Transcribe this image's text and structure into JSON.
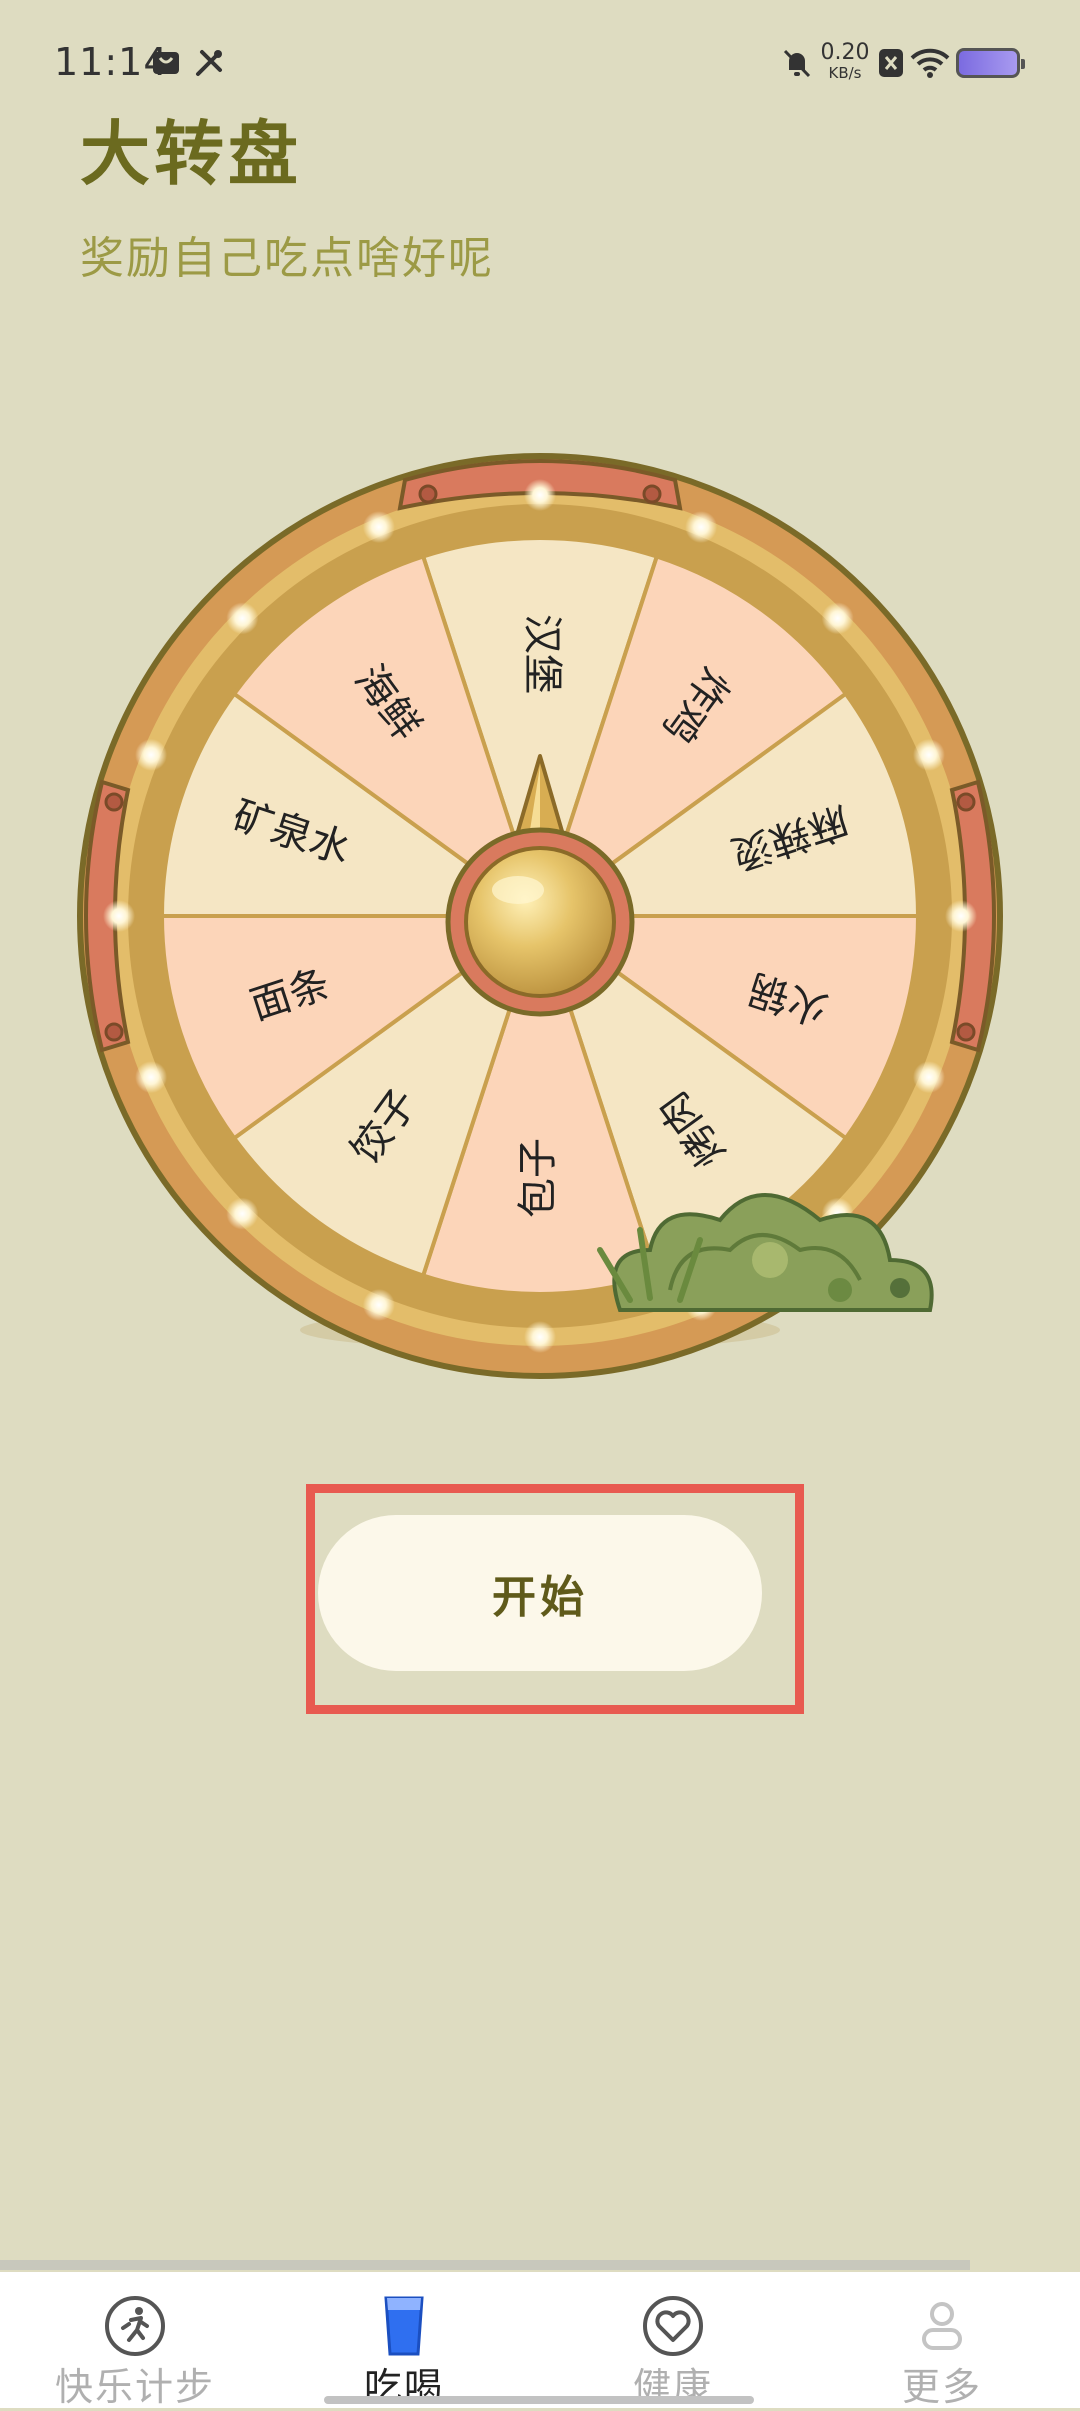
{
  "status_bar": {
    "time": "11:14",
    "net_speed_value": "0.20",
    "net_speed_unit": "KB/s",
    "icons": [
      "bag-icon",
      "tools-icon",
      "mute-icon",
      "no-sim-icon",
      "wifi-icon",
      "battery-icon"
    ]
  },
  "header": {
    "title": "大转盘",
    "subtitle": "奖励自己吃点啥好呢"
  },
  "wheel": {
    "segments": [
      "汉堡",
      "炸鸡",
      "麻辣烫",
      "火锅",
      "烤肉",
      "包子",
      "饺子",
      "面条",
      "矿泉水",
      "海鲜"
    ],
    "colors": [
      "#f5e6c4",
      "#fcd5b9"
    ],
    "rim_color": "#c9a04e",
    "bracket_color": "#d97a5e"
  },
  "start_button": {
    "label": "开始",
    "highlight_color": "#e85a50"
  },
  "bottom_nav": {
    "items": [
      {
        "label": "快乐计步",
        "icon": "running-icon",
        "active": false
      },
      {
        "label": "吃喝",
        "icon": "water-glass-icon",
        "active": true
      },
      {
        "label": "健康",
        "icon": "heart-icon",
        "active": false
      },
      {
        "label": "更多",
        "icon": "person-icon",
        "active": false
      }
    ]
  }
}
